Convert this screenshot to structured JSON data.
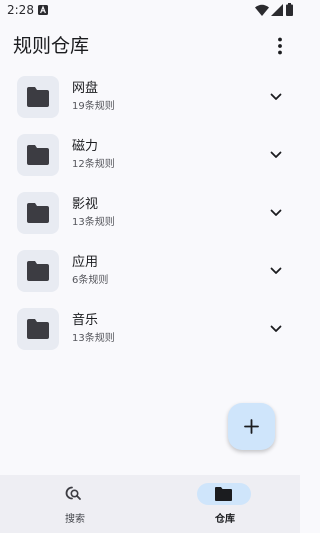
{
  "status_bar": {
    "time": "2:28",
    "icons": [
      "a-icon",
      "wifi-icon",
      "signal-icon",
      "battery-icon"
    ]
  },
  "app_bar": {
    "title": "规则仓库",
    "menu_icon": "more-vert-icon"
  },
  "folders": [
    {
      "name": "网盘",
      "count": "19条规则"
    },
    {
      "name": "磁力",
      "count": "12条规则"
    },
    {
      "name": "影视",
      "count": "13条规则"
    },
    {
      "name": "应用",
      "count": "6条规则"
    },
    {
      "name": "音乐",
      "count": "13条规则"
    }
  ],
  "fab": {
    "icon": "add-icon"
  },
  "bottom_nav": {
    "items": [
      {
        "label": "搜索",
        "icon": "search-icon",
        "active": false
      },
      {
        "label": "仓库",
        "icon": "folder-icon",
        "active": true
      }
    ]
  },
  "colors": {
    "background": "#f9f9fc",
    "folder_tile": "#e8ebf2",
    "folder_icon": "#3c3c42",
    "accent_container": "#cfe5fb",
    "nav_background": "#eeeef3"
  }
}
